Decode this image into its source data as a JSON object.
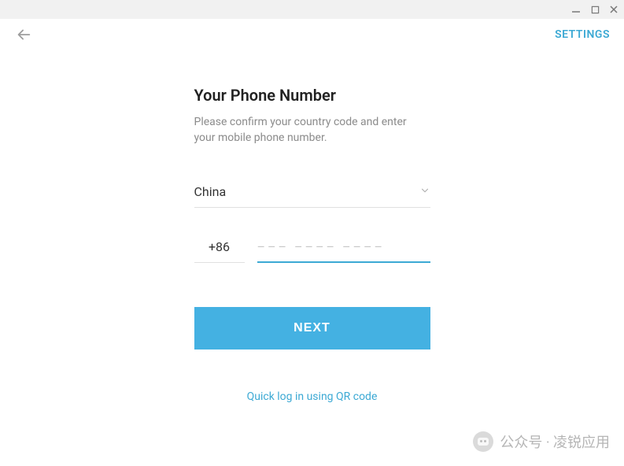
{
  "window": {
    "minimize": "minimize",
    "maximize": "maximize",
    "close": "close"
  },
  "topbar": {
    "settings_label": "SETTINGS"
  },
  "page": {
    "title": "Your Phone Number",
    "subtitle": "Please confirm your country code and enter your mobile phone number."
  },
  "country": {
    "selected": "China",
    "code": "+86"
  },
  "phone": {
    "placeholder": "––– –––– ––––",
    "value": ""
  },
  "actions": {
    "next_label": "NEXT",
    "qr_link_label": "Quick log in using QR code"
  },
  "watermark": {
    "text": "公众号 · 凌锐应用"
  }
}
